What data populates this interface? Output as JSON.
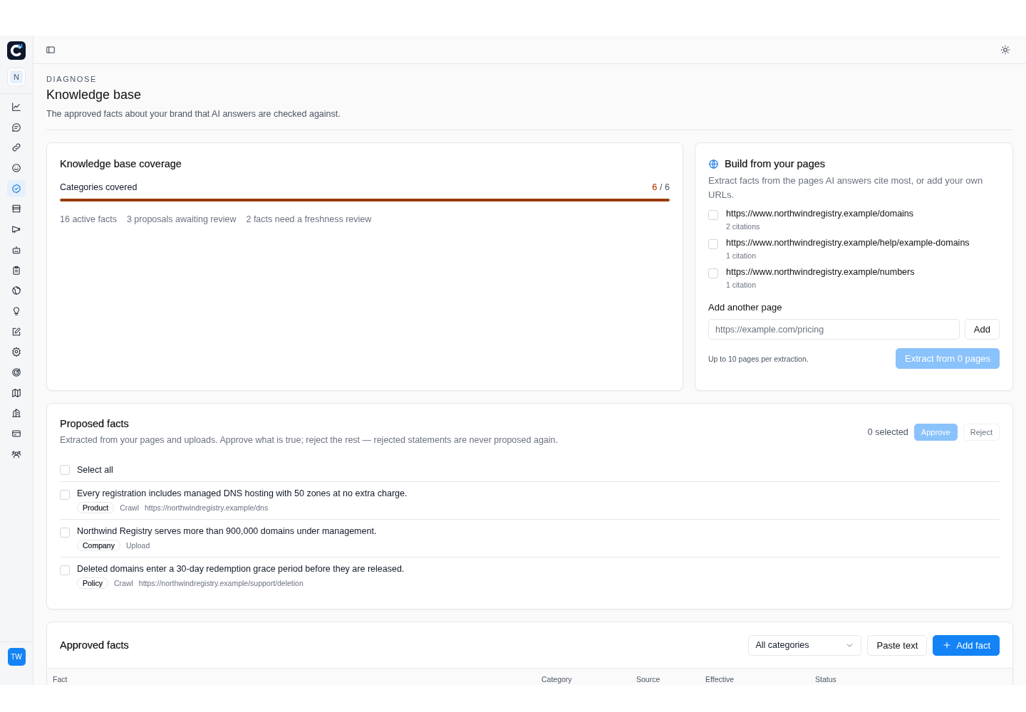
{
  "sidebar": {
    "workspace": "N",
    "items": [
      {
        "selected": false
      },
      {
        "selected": false
      },
      {
        "selected": false
      },
      {
        "selected": false
      },
      {
        "selected": true
      },
      {
        "selected": false
      },
      {
        "selected": false
      },
      {
        "selected": false
      },
      {
        "selected": false
      },
      {
        "selected": false
      },
      {
        "selected": false
      },
      {
        "selected": false
      },
      {
        "selected": false
      },
      {
        "selected": false
      },
      {
        "selected": false
      },
      {
        "selected": false
      },
      {
        "selected": false
      },
      {
        "selected": false
      }
    ],
    "user": "TW"
  },
  "header": {
    "eyebrow": "DIAGNOSE",
    "title": "Knowledge base",
    "description": "The approved facts about your brand that AI answers are checked against."
  },
  "coverage": {
    "title": "Knowledge base coverage",
    "label": "Categories covered",
    "covered": "6",
    "total": "/ 6",
    "level": 1,
    "stats": [
      "16 active facts",
      "3 proposals awaiting review",
      "2 facts need a freshness review"
    ]
  },
  "build": {
    "title": "Build from your pages",
    "description": "Extract facts from the pages AI answers cite most, or add your own URLs.",
    "pages": [
      {
        "url": "https://www.northwindregistry.example/domains",
        "citations": "2 citations",
        "checked": false
      },
      {
        "url": "https://www.northwindregistry.example/help/example-domains",
        "citations": "1 citation",
        "checked": false
      },
      {
        "url": "https://www.northwindregistry.example/numbers",
        "citations": "1 citation",
        "checked": false
      }
    ],
    "add_label": "Add another page",
    "placeholder": "https://example.com/pricing",
    "add_button": "Add",
    "note": "Up to 10 pages per extraction.",
    "extract_button": "Extract from 0 pages",
    "extract_disabled": true
  },
  "proposed": {
    "title": "Proposed facts",
    "description": "Extracted from your pages and uploads. Approve what is true; reject the rest — rejected statements are never proposed again.",
    "selected_count": "0 selected",
    "approve": "Approve",
    "approve_disabled": true,
    "reject": "Reject",
    "select_all": {
      "label": "Select all",
      "checked": false
    },
    "facts": [
      {
        "text": "Every registration includes managed DNS hosting with 50 zones at no extra charge.",
        "category": "Product",
        "source": "Crawl",
        "url": "https://northwindregistry.example/dns",
        "checked": false
      },
      {
        "text": "Northwind Registry serves more than 900,000 domains under management.",
        "category": "Company",
        "source": "Upload",
        "checked": false
      },
      {
        "text": "Deleted domains enter a 30-day redemption grace period before they are released.",
        "category": "Policy",
        "source": "Crawl",
        "url": "https://northwindregistry.example/support/deletion",
        "checked": false
      }
    ]
  },
  "approved": {
    "title": "Approved facts",
    "filter": "All categories",
    "paste_button": "Paste text",
    "add_button": "Add fact",
    "columns": [
      "Fact",
      "Category",
      "Source",
      "Effective",
      "Status"
    ]
  }
}
